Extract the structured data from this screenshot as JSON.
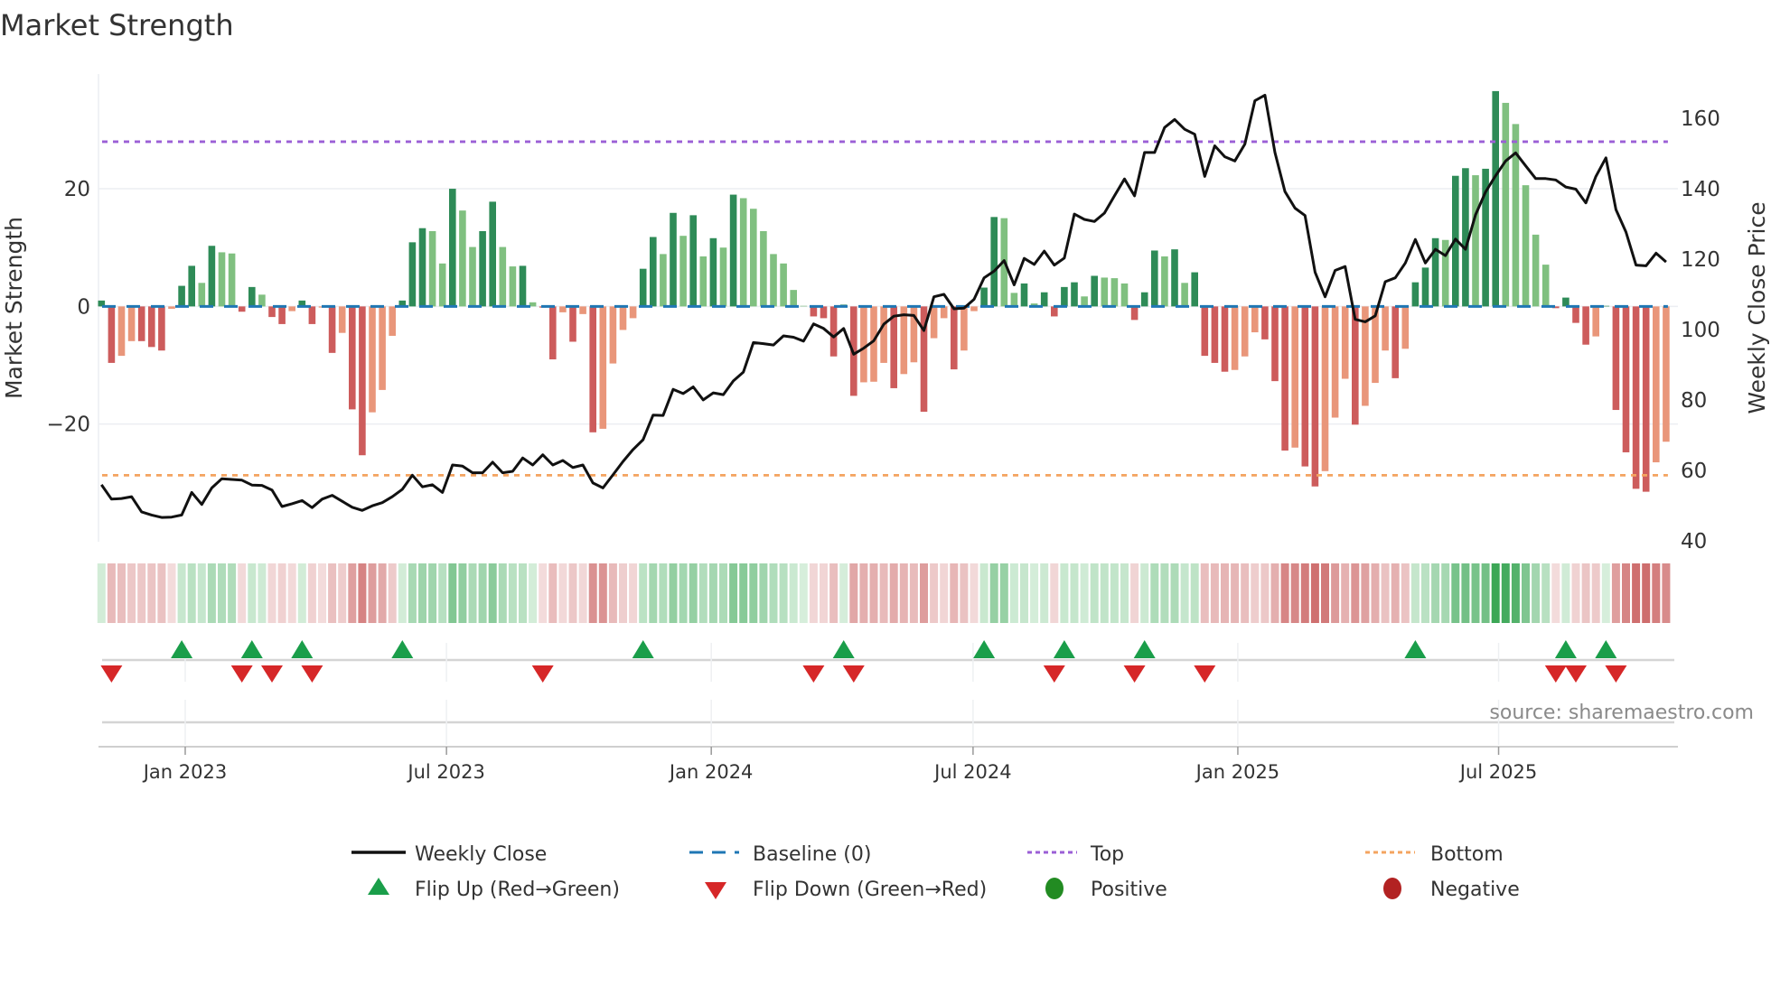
{
  "title": "Market Strength",
  "source_label": "source: sharemaestro.com",
  "colors": {
    "pos_strong": "#2e8b57",
    "pos_weak": "#80c080",
    "neg_strong": "#cd5c5c",
    "neg_weak": "#e9967a",
    "baseline": "#1f77b4",
    "top": "#9b5fd6",
    "bottom": "#f4a460",
    "flip_up": "#1a9e4a",
    "flip_down": "#d62728",
    "positive_dot": "#228b22",
    "negative_dot": "#b22222",
    "price_line": "#111111"
  },
  "chart_data": {
    "type": "bar+line",
    "title": "Market Strength",
    "ylabel_left": "Market Strength",
    "ylabel_right": "Weekly Close Price",
    "ylim_left": [
      -40,
      39.5
    ],
    "ylim_right": [
      39.7,
      172.6
    ],
    "left_ticks": [
      {
        "value": 20,
        "label": "20"
      },
      {
        "value": 0,
        "label": "0"
      },
      {
        "value": -20,
        "label": "−20"
      }
    ],
    "right_ticks": [
      {
        "value": 160,
        "label": "160"
      },
      {
        "value": 140,
        "label": "140"
      },
      {
        "value": 120,
        "label": "120"
      },
      {
        "value": 100,
        "label": "100"
      },
      {
        "value": 80,
        "label": "80"
      },
      {
        "value": 60,
        "label": "60"
      },
      {
        "value": 40,
        "label": "40"
      }
    ],
    "x_ticks": [
      {
        "week": 8.35,
        "label": "Jan 2023"
      },
      {
        "week": 34.4,
        "label": "Jul 2023"
      },
      {
        "week": 60.8,
        "label": "Jan 2024"
      },
      {
        "week": 86.9,
        "label": "Jul 2024"
      },
      {
        "week": 113.3,
        "label": "Jan 2025"
      },
      {
        "week": 139.3,
        "label": "Jul 2025"
      }
    ],
    "top_level": 28,
    "bottom_level": -28.7,
    "baseline": 0,
    "strength": [
      1,
      -9.6,
      -8.4,
      -5.9,
      -5.9,
      -6.9,
      -7.5,
      -0.4,
      3.5,
      6.9,
      4,
      10.3,
      9.2,
      9,
      -0.9,
      3.3,
      2,
      -1.8,
      -3,
      -0.8,
      1,
      -3,
      -0.2,
      -7.9,
      -4.5,
      -17.5,
      -25.3,
      -18,
      -14.2,
      -5,
      1,
      10.9,
      13.3,
      12.8,
      7.3,
      20,
      16.3,
      10.1,
      12.8,
      17.8,
      10.1,
      6.8,
      6.9,
      0.7,
      -0.2,
      -9,
      -1,
      -6,
      -1.3,
      -21.4,
      -20.8,
      -9.7,
      -4,
      -2,
      6.4,
      11.8,
      8.9,
      15.9,
      12,
      15.5,
      8.5,
      11.6,
      10,
      19,
      18.4,
      16.6,
      12.8,
      8.9,
      7.3,
      2.8,
      0.1,
      -1.7,
      -2,
      -8.5,
      0.3,
      -15.2,
      -12.9,
      -12.8,
      -9.6,
      -13.9,
      -11.5,
      -9.5,
      -17.9,
      -5.4,
      -2,
      -10.7,
      -7.5,
      -0.8,
      3.2,
      15.2,
      15,
      2.3,
      3.9,
      0.5,
      2.4,
      -1.7,
      3.3,
      4.1,
      1.7,
      5.2,
      4.9,
      4.8,
      3.9,
      -2.3,
      2.4,
      9.5,
      8.5,
      9.7,
      4,
      5.8,
      -8.4,
      -9.6,
      -11.1,
      -10.8,
      -8.5,
      -4.4,
      -5.6,
      -12.7,
      -24.5,
      -24,
      -27.2,
      -30.6,
      -28,
      -18.9,
      -12.3,
      -20.1,
      -16.9,
      -13,
      -7.5,
      -12.2,
      -7.2,
      4.1,
      6.6,
      11.6,
      11.3,
      22.2,
      23.5,
      22.3,
      23.4,
      36.6,
      34.6,
      31,
      20.6,
      12.2,
      7.1,
      -0.3,
      1.5,
      -2.8,
      -6.5,
      -5.1,
      0.1,
      -17.6,
      -24.8,
      -31,
      -31.5,
      -26.5,
      -23
    ],
    "weekly_close": [
      55.9,
      51.8,
      52.0,
      52.5,
      48.2,
      47.3,
      46.6,
      46.7,
      47.3,
      53.7,
      50.3,
      55.0,
      57.6,
      57.4,
      57.2,
      55.8,
      55.7,
      54.4,
      49.7,
      50.5,
      51.4,
      49.4,
      51.8,
      52.9,
      51.2,
      49.5,
      48.6,
      49.9,
      50.8,
      52.5,
      54.6,
      58.6,
      55.3,
      55.9,
      53.7,
      61.5,
      61.2,
      59.3,
      59.3,
      62.3,
      59.3,
      59.7,
      63.5,
      61.5,
      64.4,
      61.5,
      62.8,
      60.8,
      61.5,
      56.4,
      55.0,
      58.7,
      62.5,
      65.9,
      68.7,
      75.7,
      75.6,
      83.0,
      81.8,
      83.7,
      80.0,
      82.0,
      81.5,
      85.4,
      87.9,
      96.3,
      96.0,
      95.6,
      98.2,
      97.8,
      96.7,
      101.6,
      100.3,
      97.9,
      100.3,
      93.0,
      94.7,
      96.8,
      101.5,
      103.8,
      104.2,
      104.0,
      99.7,
      109.3,
      110.0,
      105.9,
      106.1,
      108.6,
      114.7,
      116.6,
      119.6,
      112.7,
      120.2,
      118.5,
      122.3,
      118.3,
      120.3,
      132.8,
      131.3,
      130.7,
      133.1,
      138.0,
      142.8,
      138.0,
      150.3,
      150.3,
      157.4,
      159.7,
      156.9,
      155.5,
      143.5,
      152.2,
      149.1,
      147.9,
      152.7,
      165.0,
      166.6,
      150.3,
      139.2,
      134.5,
      132.4,
      116.3,
      109.3,
      116.8,
      117.9,
      102.9,
      102.2,
      103.9,
      113.6,
      114.7,
      118.9,
      125.6,
      118.9,
      122.8,
      121.0,
      125.7,
      122.8,
      132.6,
      139.1,
      143.7,
      147.9,
      150.2,
      146.5,
      142.9,
      142.9,
      142.5,
      140.5,
      139.9,
      136.0,
      143.5,
      148.8,
      134.1,
      127.7,
      118.3,
      118.1,
      121.7,
      119.2
    ],
    "flip_up_weeks": [
      8,
      15,
      20,
      30,
      54,
      74,
      88,
      96,
      104,
      131,
      146,
      150
    ],
    "flip_down_weeks": [
      1,
      14,
      17,
      21,
      44,
      71,
      75,
      95,
      103,
      110,
      145,
      147,
      151
    ],
    "grid": true,
    "legend_placement": "bottom-center",
    "legend": {
      "weekly_close": "Weekly Close",
      "baseline": "Baseline (0)",
      "top": "Top",
      "bottom": "Bottom",
      "flip_up": "Flip Up (Red→Green)",
      "flip_down": "Flip Down (Green→Red)",
      "positive": "Positive",
      "negative": "Negative"
    }
  }
}
